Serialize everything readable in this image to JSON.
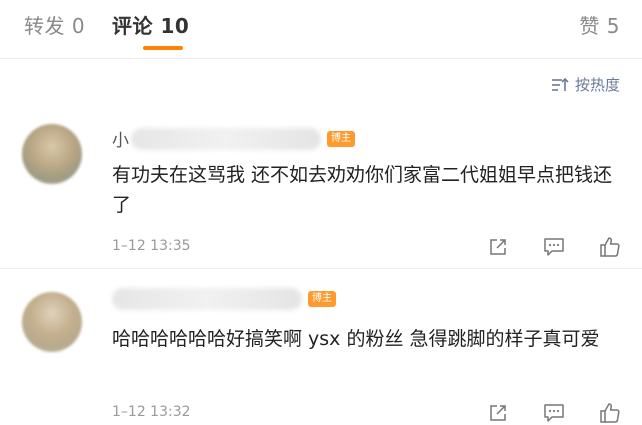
{
  "tabs": {
    "repost": "转发 0",
    "comments": "评论 10",
    "likes": "赞 5"
  },
  "sort": {
    "label": "按热度",
    "icon": "sort-icon"
  },
  "comments": [
    {
      "username": "小",
      "badge": "博主",
      "text": "有功夫在这骂我 还不如去劝劝你们家富二代姐姐早点把钱还了",
      "time": "1–12 13:35"
    },
    {
      "username": "",
      "badge": "博主",
      "text": "哈哈哈哈哈哈好搞笑啊 ysx 的粉丝 急得跳脚的样子真可爱",
      "time": "1–12 13:32"
    }
  ],
  "colors": {
    "accent": "#ff8200",
    "badge": "#ff9a2e",
    "link": "#6b7a99"
  }
}
